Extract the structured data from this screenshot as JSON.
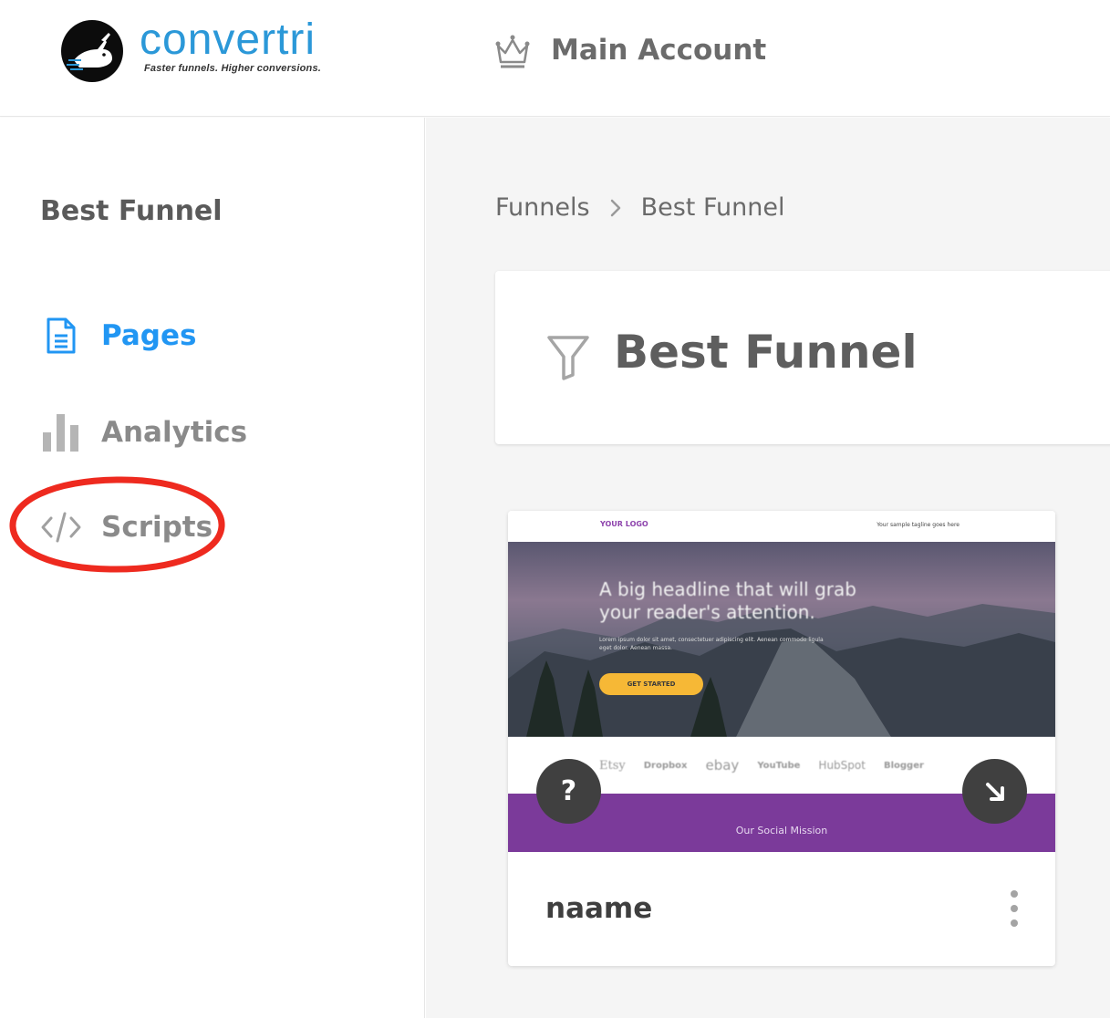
{
  "header": {
    "logo_text": "convertri",
    "logo_tagline": "Faster funnels. Higher conversions.",
    "account_label": "Main Account",
    "account_icon": "crown-icon"
  },
  "sidebar": {
    "funnel_name": "Best Funnel",
    "items": [
      {
        "label": "Pages",
        "icon": "document-icon",
        "active": true
      },
      {
        "label": "Analytics",
        "icon": "bar-chart-icon",
        "active": false
      },
      {
        "label": "Scripts",
        "icon": "code-icon",
        "active": false
      }
    ]
  },
  "main": {
    "breadcrumb": [
      "Funnels",
      "Best Funnel"
    ],
    "title": "Best Funnel",
    "title_icon": "filter-icon",
    "pages": [
      {
        "name": "naame",
        "thumbnail": {
          "logo": "YOUR LOGO",
          "tagline": "Your sample tagline goes here",
          "headline": "A big headline that will grab your reader's attention.",
          "subtext": "Lorem ipsum dolor sit amet, consectetuer adipiscing elit. Aenean commodo ligula eget dolor. Aenean massa.",
          "button": "GET STARTED",
          "brand_logos": [
            "Etsy",
            "Dropbox",
            "ebay",
            "YouTube",
            "HubSpot",
            "Blogger"
          ],
          "section_title": "Our Social Mission"
        },
        "help_label": "?"
      }
    ]
  },
  "colors": {
    "accent_blue": "#2196f3",
    "logo_blue": "#2b98d8",
    "annotation_red": "#ee2a1f",
    "thumb_purple": "#7b3a9a",
    "thumb_button": "#f6b836"
  }
}
